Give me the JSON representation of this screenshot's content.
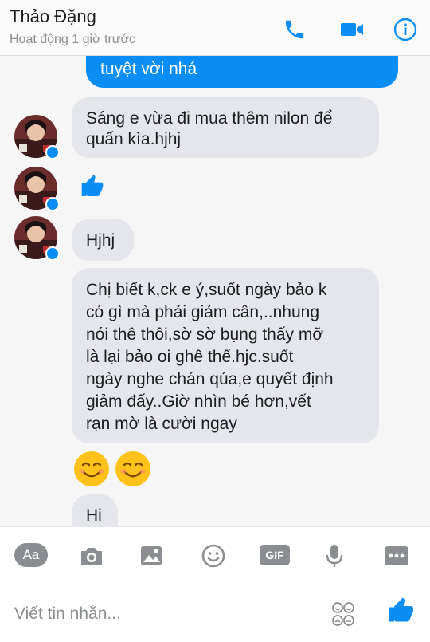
{
  "header": {
    "contact_name": "Thảo Đặng",
    "status": "Hoạt động 1 giờ trước",
    "icons": [
      "phone-icon",
      "video-camera-icon",
      "info-icon"
    ]
  },
  "messages": [
    {
      "sender": "me",
      "type": "text",
      "text": "tuyệt vời nhá"
    },
    {
      "sender": "contact",
      "type": "text",
      "lines": [
        "Sáng e vừa đi mua thêm nilon để",
        "quấn kìa.hjhj"
      ]
    },
    {
      "sender": "contact",
      "type": "like"
    },
    {
      "sender": "contact",
      "type": "text",
      "text": "Hjhj"
    },
    {
      "sender": "contact",
      "type": "text",
      "lines": [
        "Chị biết k,ck e ý,suốt ngày bảo k",
        "có gì mà phải giảm cân,..nhung",
        "nói thê thôi,sờ sờ bụng thấy mỡ",
        "là lại bảo oi ghê thế.hjc.suốt",
        "ngày nghe chán qúa,e quyết định",
        "giảm đấy..Giờ nhìn bé hơn,vết",
        "rạn mờ là cười ngay"
      ]
    },
    {
      "sender": "contact",
      "type": "emoji",
      "emoji": [
        "smiling-face",
        "smiling-face"
      ]
    },
    {
      "sender": "contact",
      "type": "text",
      "text": "Hi"
    }
  ],
  "toolbar": {
    "aa_label": "Aa",
    "gif_label": "GIF",
    "icons": [
      "camera-icon",
      "gallery-icon",
      "sticker-icon",
      "gif-icon",
      "microphone-icon",
      "more-icon"
    ]
  },
  "composer": {
    "placeholder": "Viết tin nhắn...",
    "value": ""
  },
  "colors": {
    "accent": "#0a8df5",
    "incoming_bubble": "#e4e6eb",
    "icon_gray": "#8a8d91",
    "emoji_yellow": "#ffc21a"
  }
}
